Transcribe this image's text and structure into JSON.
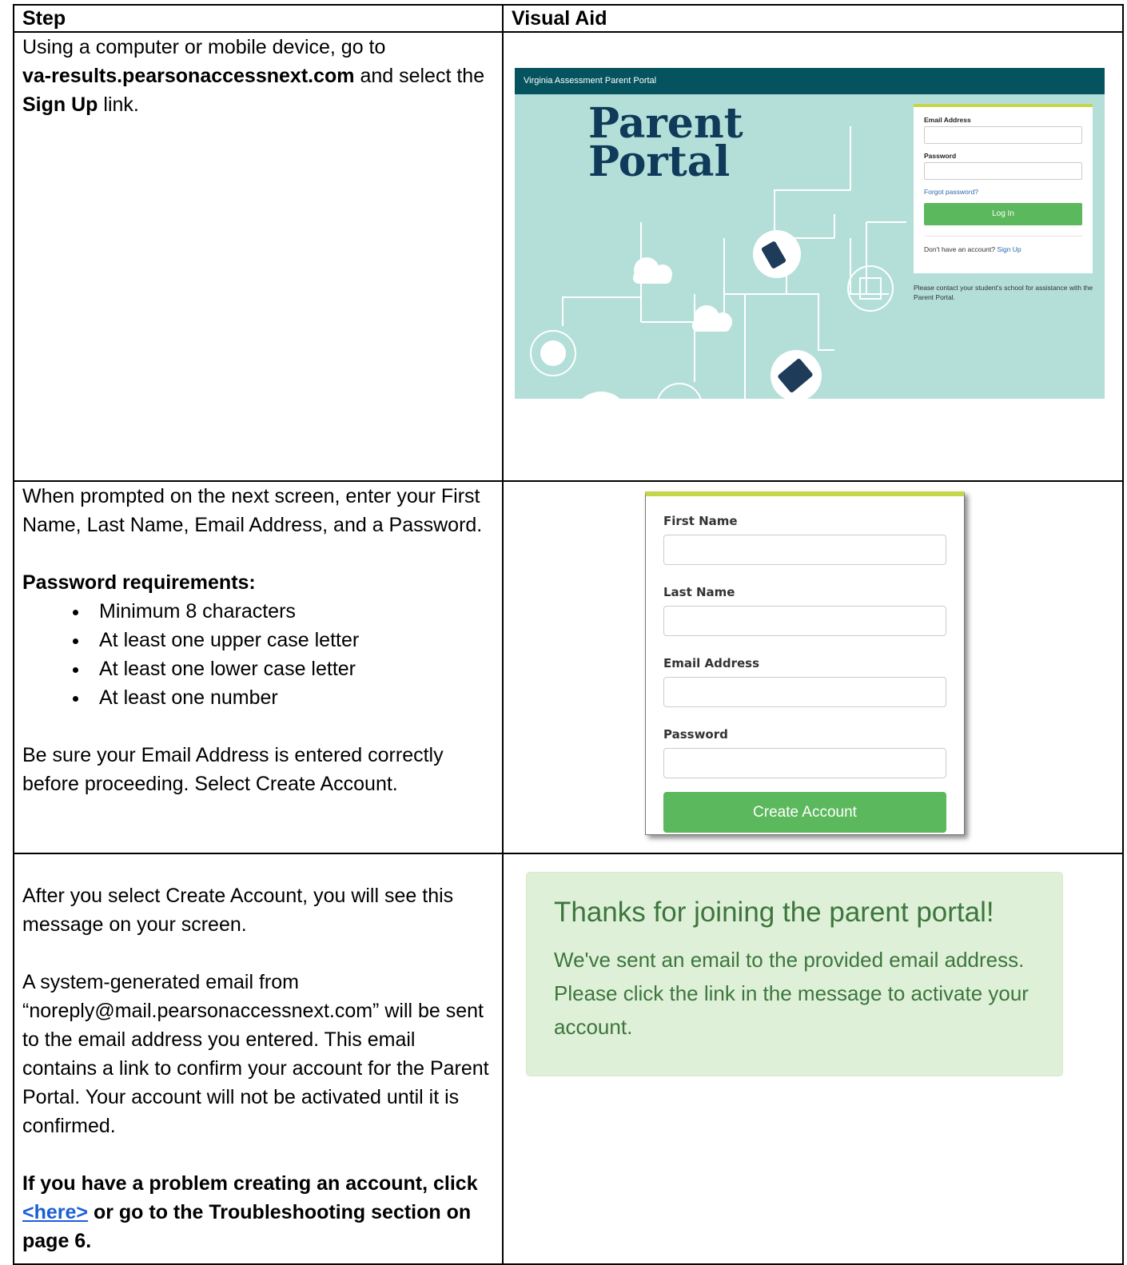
{
  "header": {
    "step": "Step",
    "visual_aid": "Visual Aid"
  },
  "row1": {
    "p1": "Using a computer or mobile device, go to",
    "url": "va-results.pearsonaccessnext.com",
    "p2": " and select the ",
    "signup": "Sign Up",
    "p3": " link."
  },
  "portal": {
    "bar_title": "Virginia Assessment Parent Portal",
    "hero_line1": "Parent",
    "hero_line2": "Portal",
    "email_label": "Email Address",
    "password_label": "Password",
    "forgot": "Forgot password?",
    "login_button": "Log In",
    "no_account": "Don't have an account?",
    "sign_up_link": "Sign Up",
    "contact": "Please contact your student's school for assistance with the Parent Portal."
  },
  "row2": {
    "intro": "When prompted on the next screen, enter your First Name, Last Name, Email Address, and a Password.",
    "req_title": "Password requirements:",
    "reqs": [
      "Minimum 8 characters",
      "At least one upper case letter",
      "At least one lower case letter",
      "At least one number"
    ],
    "closing": "Be sure your Email Address is entered correctly before proceeding. Select Create Account."
  },
  "signup_form": {
    "first_name": "First Name",
    "last_name": "Last Name",
    "email": "Email Address",
    "password": "Password",
    "button": "Create Account"
  },
  "row3": {
    "p1": "After you select Create Account, you will see this message on your screen.",
    "p2": "A system-generated email from “noreply@mail.pearsonaccessnext.com” will be sent to the email address you entered. This email contains a link to confirm your account for the Parent Portal. Your account will not be activated until it is confirmed.",
    "p3a": "If you have a problem creating an account, click ",
    "link": "<here>",
    "p3b": " or go to the Troubleshooting section on page 6."
  },
  "success": {
    "heading": "Thanks for joining the parent portal!",
    "message": "We've sent an email to the provided email address. Please click the link in the message to activate your account."
  },
  "colors": {
    "portal_bar": "#05535f",
    "portal_bg": "#b3dfd8",
    "accent": "#c5d64a",
    "button_green": "#5cb85c",
    "success_bg": "#dff0d8",
    "success_text": "#3c763d",
    "link": "#1a5fd6"
  }
}
